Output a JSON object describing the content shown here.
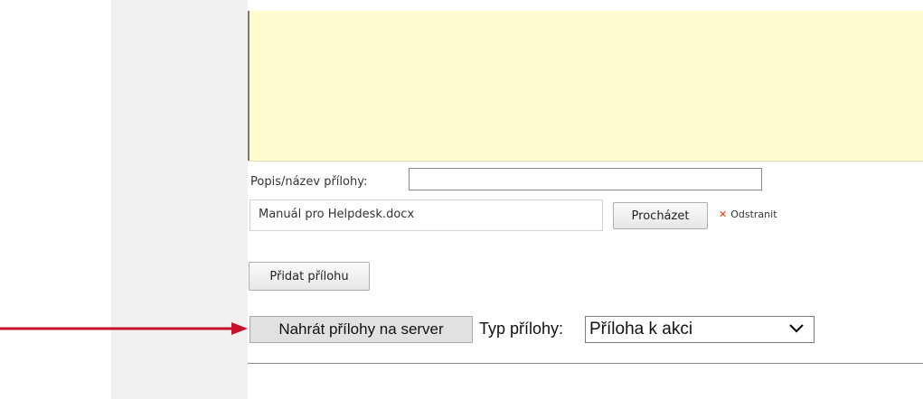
{
  "attachment_form": {
    "description_label": "Popis/název přílohy:",
    "description_value": "",
    "file_name": "Manuál pro Helpdesk.docx",
    "browse_label": "Procházet",
    "remove_label": "Odstranit",
    "add_attachment_label": "Přidat přílohu"
  },
  "upload": {
    "upload_label": "Nahrát přílohy na server",
    "type_label": "Typ přílohy:",
    "type_selected": "Příloha k akci"
  },
  "colors": {
    "editor_background": "#fffdd0",
    "arrow": "#c8102e",
    "remove_icon": "#ee3b00"
  },
  "icons": {
    "remove": "close-x-icon",
    "select": "chevron-down-icon",
    "annotation": "red-arrow-icon"
  }
}
